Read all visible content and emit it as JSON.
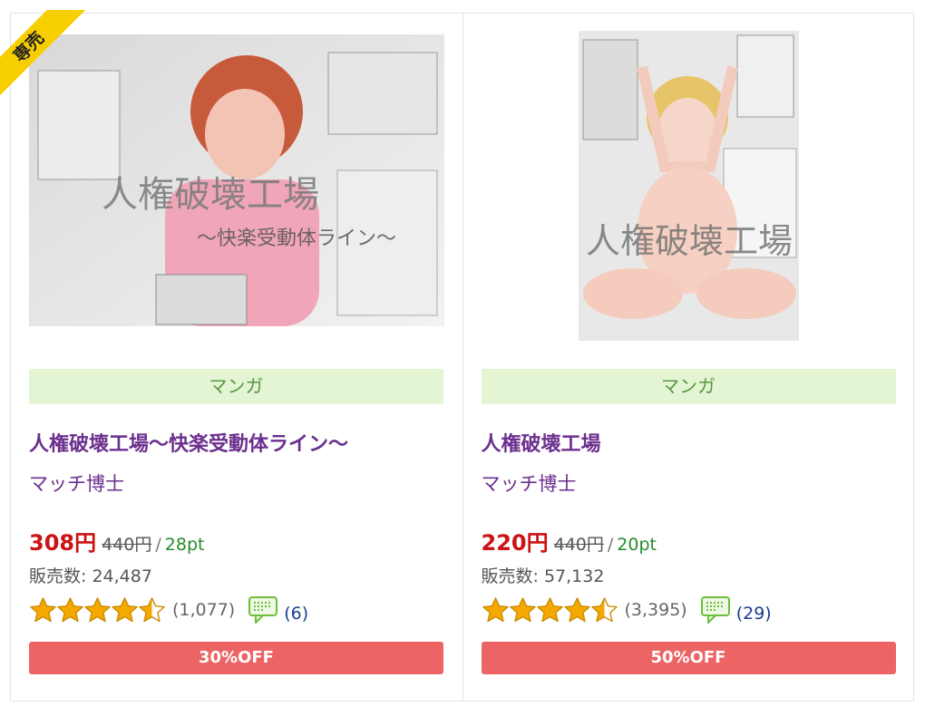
{
  "products": [
    {
      "badge": "専売",
      "genre": "マンガ",
      "title": "人権破壊工場〜快楽受動体ライン〜",
      "author": "マッチ博士",
      "price": "308円",
      "original_price": "440円",
      "separator": "/",
      "points": "28pt",
      "sales": "販売数: 24,487",
      "rating": 4.5,
      "rating_count": "(1,077)",
      "review_count": "(6)",
      "discount": "30%OFF",
      "cover_text": "人権破壊工場",
      "cover_subtext": "〜快楽受動体ライン〜"
    },
    {
      "genre": "マンガ",
      "title": "人権破壊工場",
      "author": "マッチ博士",
      "price": "220円",
      "original_price": "440円",
      "separator": "/",
      "points": "20pt",
      "sales": "販売数: 57,132",
      "rating": 4.5,
      "rating_count": "(3,395)",
      "review_count": "(29)",
      "discount": "50%OFF",
      "cover_text": "人権破壊工場"
    }
  ],
  "colors": {
    "title": "#6b2f8e",
    "price": "#cc1212",
    "points": "#258b2a",
    "genre_bg": "#e3f5d3",
    "genre_text": "#5a9645",
    "discount_bg": "#ec6464",
    "badge": "#f7cf00",
    "star": "#f5a800"
  }
}
